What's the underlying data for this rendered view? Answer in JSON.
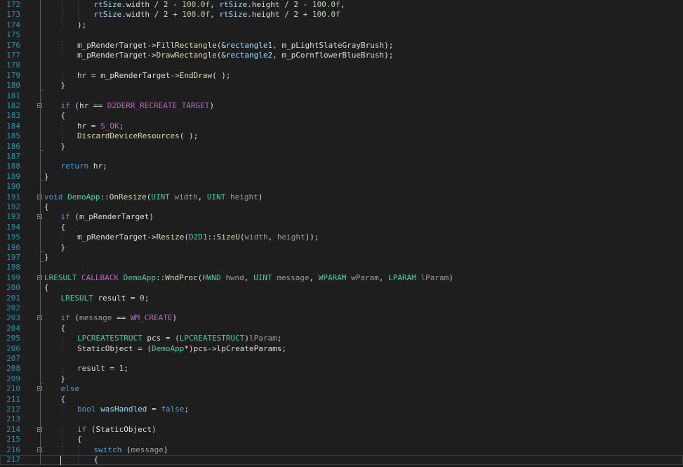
{
  "editor": {
    "lines": [
      {
        "num": "172",
        "indent": 3,
        "fold": "",
        "tokens": [
          [
            "vr",
            "rtSize"
          ],
          [
            "tx",
            "."
          ],
          [
            "tx",
            "width / 2 - "
          ],
          [
            "nm",
            "100.0f"
          ],
          [
            "tx",
            ", "
          ],
          [
            "vr",
            "rtSize"
          ],
          [
            "tx",
            "."
          ],
          [
            "tx",
            "height / 2 - "
          ],
          [
            "nm",
            "100.0f"
          ],
          [
            "tx",
            ","
          ]
        ]
      },
      {
        "num": "173",
        "indent": 3,
        "fold": "",
        "tokens": [
          [
            "vr",
            "rtSize"
          ],
          [
            "tx",
            "."
          ],
          [
            "tx",
            "width / 2 + "
          ],
          [
            "nm",
            "100.0f"
          ],
          [
            "tx",
            ", "
          ],
          [
            "vr",
            "rtSize"
          ],
          [
            "tx",
            "."
          ],
          [
            "tx",
            "height / 2 + "
          ],
          [
            "nm",
            "100.0f"
          ]
        ]
      },
      {
        "num": "174",
        "indent": 2,
        "fold": "",
        "tokens": [
          [
            "tx",
            ");"
          ]
        ]
      },
      {
        "num": "175",
        "indent": 0,
        "fold": "",
        "tokens": []
      },
      {
        "num": "176",
        "indent": 2,
        "fold": "",
        "tokens": [
          [
            "tx",
            "m_pRenderTarget->"
          ],
          [
            "fn",
            "FillRectangle"
          ],
          [
            "tx",
            "(&"
          ],
          [
            "vr",
            "rectangle1"
          ],
          [
            "tx",
            ", m_pLightSlateGrayBrush);"
          ]
        ]
      },
      {
        "num": "177",
        "indent": 2,
        "fold": "",
        "tokens": [
          [
            "tx",
            "m_pRenderTarget->"
          ],
          [
            "fn",
            "DrawRectangle"
          ],
          [
            "tx",
            "(&"
          ],
          [
            "vr",
            "rectangle2"
          ],
          [
            "tx",
            ", m_pCornflowerBlueBrush);"
          ]
        ]
      },
      {
        "num": "178",
        "indent": 0,
        "fold": "",
        "tokens": []
      },
      {
        "num": "179",
        "indent": 2,
        "fold": "",
        "tokens": [
          [
            "tx",
            "hr = m_pRenderTarget->"
          ],
          [
            "fn",
            "EndDraw"
          ],
          [
            "tx",
            "( );"
          ]
        ]
      },
      {
        "num": "180",
        "indent": 1,
        "fold": "",
        "tokens": [
          [
            "tx",
            "}"
          ]
        ]
      },
      {
        "num": "181",
        "indent": 0,
        "fold": "",
        "tokens": []
      },
      {
        "num": "182",
        "indent": 1,
        "fold": "box",
        "tokens": [
          [
            "kw",
            "if"
          ],
          [
            "tx",
            " (hr == "
          ],
          [
            "mc",
            "D2DERR_RECREATE_TARGET"
          ],
          [
            "tx",
            ")"
          ]
        ]
      },
      {
        "num": "183",
        "indent": 1,
        "fold": "",
        "tokens": [
          [
            "tx",
            "{"
          ]
        ]
      },
      {
        "num": "184",
        "indent": 2,
        "fold": "",
        "tokens": [
          [
            "tx",
            "hr = "
          ],
          [
            "mc",
            "S_OK"
          ],
          [
            "tx",
            ";"
          ]
        ]
      },
      {
        "num": "185",
        "indent": 2,
        "fold": "",
        "tokens": [
          [
            "fn",
            "DiscardDeviceResources"
          ],
          [
            "tx",
            "( );"
          ]
        ]
      },
      {
        "num": "186",
        "indent": 1,
        "fold": "",
        "tokens": [
          [
            "tx",
            "}"
          ]
        ]
      },
      {
        "num": "187",
        "indent": 0,
        "fold": "",
        "tokens": []
      },
      {
        "num": "188",
        "indent": 1,
        "fold": "",
        "tokens": [
          [
            "kw",
            "return"
          ],
          [
            "tx",
            " hr;"
          ]
        ]
      },
      {
        "num": "189",
        "indent": 0,
        "fold": "",
        "tokens": [
          [
            "tx",
            "}"
          ]
        ]
      },
      {
        "num": "190",
        "indent": 0,
        "fold": "",
        "tokens": []
      },
      {
        "num": "191",
        "indent": 0,
        "fold": "box",
        "tokens": [
          [
            "kw",
            "void"
          ],
          [
            "tx",
            " "
          ],
          [
            "ty",
            "DemoApp"
          ],
          [
            "tx",
            "::"
          ],
          [
            "fn",
            "OnResize"
          ],
          [
            "tx",
            "("
          ],
          [
            "ty",
            "UINT"
          ],
          [
            "tx",
            " "
          ],
          [
            "pm",
            "width"
          ],
          [
            "tx",
            ", "
          ],
          [
            "ty",
            "UINT"
          ],
          [
            "tx",
            " "
          ],
          [
            "pm",
            "height"
          ],
          [
            "tx",
            ")"
          ]
        ]
      },
      {
        "num": "192",
        "indent": 0,
        "fold": "",
        "tokens": [
          [
            "tx",
            "{"
          ]
        ]
      },
      {
        "num": "193",
        "indent": 1,
        "fold": "box",
        "tokens": [
          [
            "kw",
            "if"
          ],
          [
            "tx",
            " (m_pRenderTarget)"
          ]
        ]
      },
      {
        "num": "194",
        "indent": 1,
        "fold": "",
        "tokens": [
          [
            "tx",
            "{"
          ]
        ]
      },
      {
        "num": "195",
        "indent": 2,
        "fold": "",
        "tokens": [
          [
            "tx",
            "m_pRenderTarget->"
          ],
          [
            "fn",
            "Resize"
          ],
          [
            "tx",
            "("
          ],
          [
            "ty",
            "D2D1"
          ],
          [
            "tx",
            "::"
          ],
          [
            "fn",
            "SizeU"
          ],
          [
            "tx",
            "("
          ],
          [
            "pm",
            "width"
          ],
          [
            "tx",
            ", "
          ],
          [
            "pm",
            "height"
          ],
          [
            "tx",
            "));"
          ]
        ]
      },
      {
        "num": "196",
        "indent": 1,
        "fold": "",
        "tokens": [
          [
            "tx",
            "}"
          ]
        ]
      },
      {
        "num": "197",
        "indent": 0,
        "fold": "",
        "tokens": [
          [
            "tx",
            "}"
          ]
        ]
      },
      {
        "num": "198",
        "indent": 0,
        "fold": "",
        "tokens": []
      },
      {
        "num": "199",
        "indent": 0,
        "fold": "box",
        "tokens": [
          [
            "ty",
            "LRESULT"
          ],
          [
            "tx",
            " "
          ],
          [
            "mc",
            "CALLBACK"
          ],
          [
            "tx",
            " "
          ],
          [
            "ty",
            "DemoApp"
          ],
          [
            "tx",
            "::"
          ],
          [
            "fn",
            "WndProc"
          ],
          [
            "tx",
            "("
          ],
          [
            "ty",
            "HWND"
          ],
          [
            "tx",
            " "
          ],
          [
            "pm",
            "hwnd"
          ],
          [
            "tx",
            ", "
          ],
          [
            "ty",
            "UINT"
          ],
          [
            "tx",
            " "
          ],
          [
            "pm",
            "message"
          ],
          [
            "tx",
            ", "
          ],
          [
            "ty",
            "WPARAM"
          ],
          [
            "tx",
            " "
          ],
          [
            "pm",
            "wParam"
          ],
          [
            "tx",
            ", "
          ],
          [
            "ty",
            "LPARAM"
          ],
          [
            "tx",
            " "
          ],
          [
            "pm",
            "lParam"
          ],
          [
            "tx",
            ")"
          ]
        ]
      },
      {
        "num": "200",
        "indent": 0,
        "fold": "",
        "tokens": [
          [
            "tx",
            "{"
          ]
        ]
      },
      {
        "num": "201",
        "indent": 1,
        "fold": "",
        "tokens": [
          [
            "ty",
            "LRESULT"
          ],
          [
            "tx",
            " result = "
          ],
          [
            "nm",
            "0"
          ],
          [
            "tx",
            ";"
          ]
        ]
      },
      {
        "num": "202",
        "indent": 0,
        "fold": "",
        "tokens": []
      },
      {
        "num": "203",
        "indent": 1,
        "fold": "box",
        "tokens": [
          [
            "kw",
            "if"
          ],
          [
            "tx",
            " ("
          ],
          [
            "pm",
            "message"
          ],
          [
            "tx",
            " == "
          ],
          [
            "mc",
            "WM_CREATE"
          ],
          [
            "tx",
            ")"
          ]
        ]
      },
      {
        "num": "204",
        "indent": 1,
        "fold": "",
        "tokens": [
          [
            "tx",
            "{"
          ]
        ]
      },
      {
        "num": "205",
        "indent": 2,
        "fold": "",
        "tokens": [
          [
            "ty",
            "LPCREATESTRUCT"
          ],
          [
            "tx",
            " pcs = ("
          ],
          [
            "ty",
            "LPCREATESTRUCT"
          ],
          [
            "tx",
            ")"
          ],
          [
            "pm",
            "lParam"
          ],
          [
            "tx",
            ";"
          ]
        ]
      },
      {
        "num": "206",
        "indent": 2,
        "fold": "",
        "tokens": [
          [
            "tx",
            "StaticObject = ("
          ],
          [
            "ty",
            "DemoApp"
          ],
          [
            "tx",
            "*)pcs->lpCreateParams;"
          ]
        ]
      },
      {
        "num": "207",
        "indent": 0,
        "fold": "",
        "tokens": []
      },
      {
        "num": "208",
        "indent": 2,
        "fold": "",
        "tokens": [
          [
            "tx",
            "result = "
          ],
          [
            "nm",
            "1"
          ],
          [
            "tx",
            ";"
          ]
        ]
      },
      {
        "num": "209",
        "indent": 1,
        "fold": "",
        "tokens": [
          [
            "tx",
            "}"
          ]
        ]
      },
      {
        "num": "210",
        "indent": 1,
        "fold": "box",
        "tokens": [
          [
            "kw",
            "else"
          ]
        ]
      },
      {
        "num": "211",
        "indent": 1,
        "fold": "",
        "tokens": [
          [
            "tx",
            "{"
          ]
        ]
      },
      {
        "num": "212",
        "indent": 2,
        "fold": "",
        "tokens": [
          [
            "kw",
            "bool"
          ],
          [
            "tx",
            " "
          ],
          [
            "vr",
            "wasHandled"
          ],
          [
            "tx",
            " = "
          ],
          [
            "kw",
            "false"
          ],
          [
            "tx",
            ";"
          ]
        ]
      },
      {
        "num": "213",
        "indent": 0,
        "fold": "",
        "tokens": []
      },
      {
        "num": "214",
        "indent": 2,
        "fold": "box",
        "tokens": [
          [
            "kw",
            "if"
          ],
          [
            "tx",
            " (StaticObject)"
          ]
        ]
      },
      {
        "num": "215",
        "indent": 2,
        "fold": "",
        "tokens": [
          [
            "tx",
            "{"
          ]
        ]
      },
      {
        "num": "216",
        "indent": 3,
        "fold": "box",
        "tokens": [
          [
            "kw",
            "switch"
          ],
          [
            "tx",
            " ("
          ],
          [
            "pm",
            "message"
          ],
          [
            "tx",
            ")"
          ]
        ]
      },
      {
        "num": "217",
        "indent": 3,
        "fold": "",
        "current": true,
        "tokens": [
          [
            "tx",
            "{"
          ]
        ]
      }
    ]
  }
}
